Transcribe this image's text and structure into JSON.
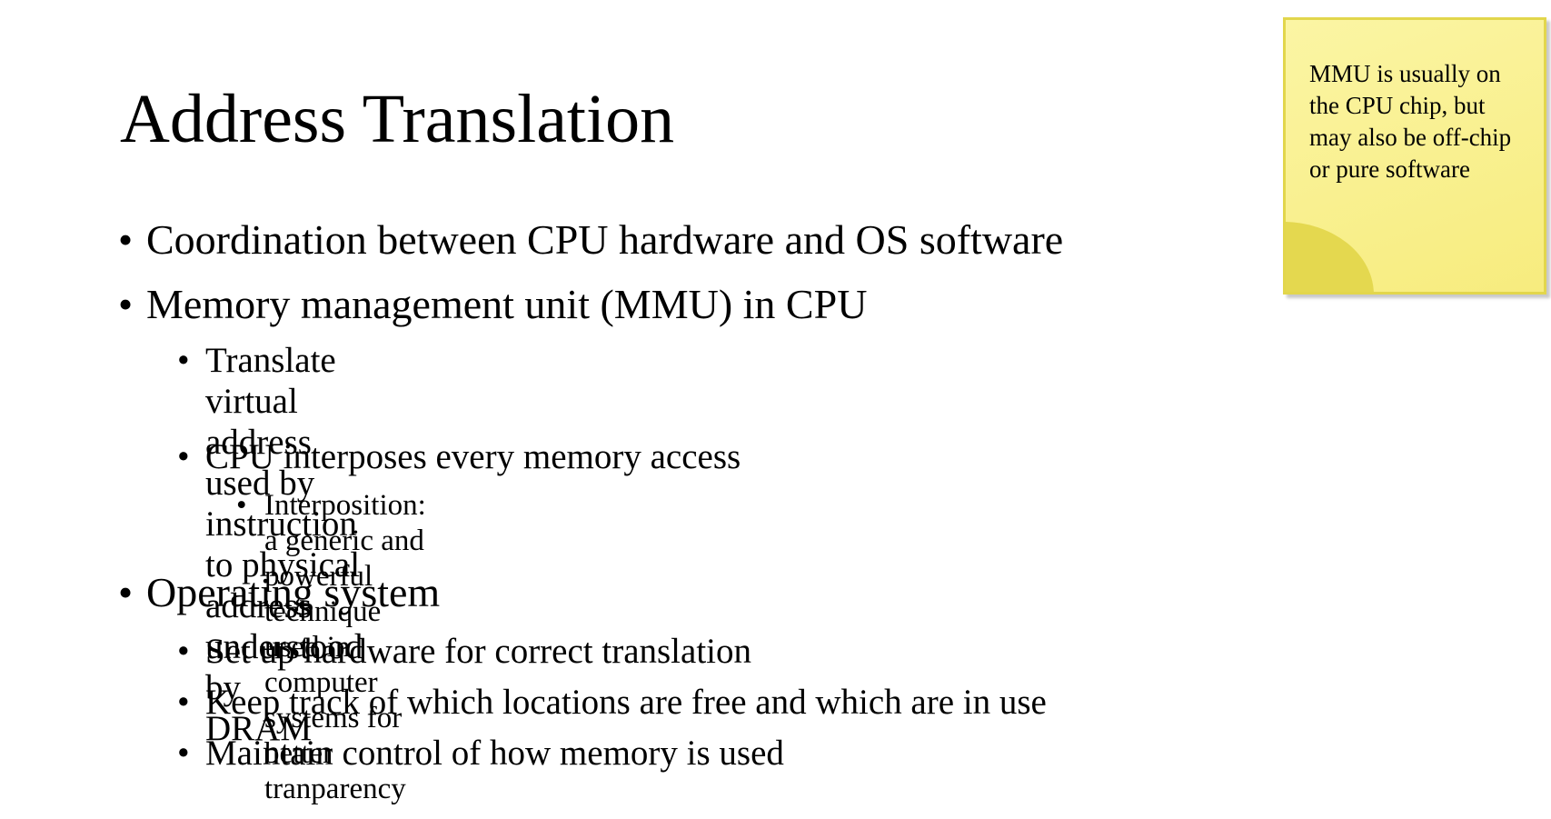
{
  "slide": {
    "title": "Address Translation",
    "bullets": [
      {
        "level": 1,
        "text": "Coordination between CPU hardware and OS software"
      },
      {
        "level": 1,
        "text": "Memory management unit (MMU) in CPU"
      },
      {
        "level": 2,
        "text": "Translate virtual address used by instruction to physical address understood by\nDRAM"
      },
      {
        "level": 2,
        "text": "CPU interposes every memory access"
      },
      {
        "level": 3,
        "text": "Interposition: a generic and powerful technique used in computer systems for better\ntranparency"
      },
      {
        "level": 1,
        "text": "Operating system"
      },
      {
        "level": 2,
        "text": "Set up hardware for correct translation"
      },
      {
        "level": 2,
        "text": "Keep track of which locations are free and which are in use"
      },
      {
        "level": 2,
        "text": "Maintain control of how memory is used"
      }
    ],
    "bullet_glyph": "•"
  },
  "sticky_note": {
    "text": "MMU is usually on the CPU chip, but may also be off-chip or pure software",
    "colors": {
      "fill": "#faf08c",
      "border": "#e2d64c",
      "curl": "#e4d84f"
    }
  }
}
